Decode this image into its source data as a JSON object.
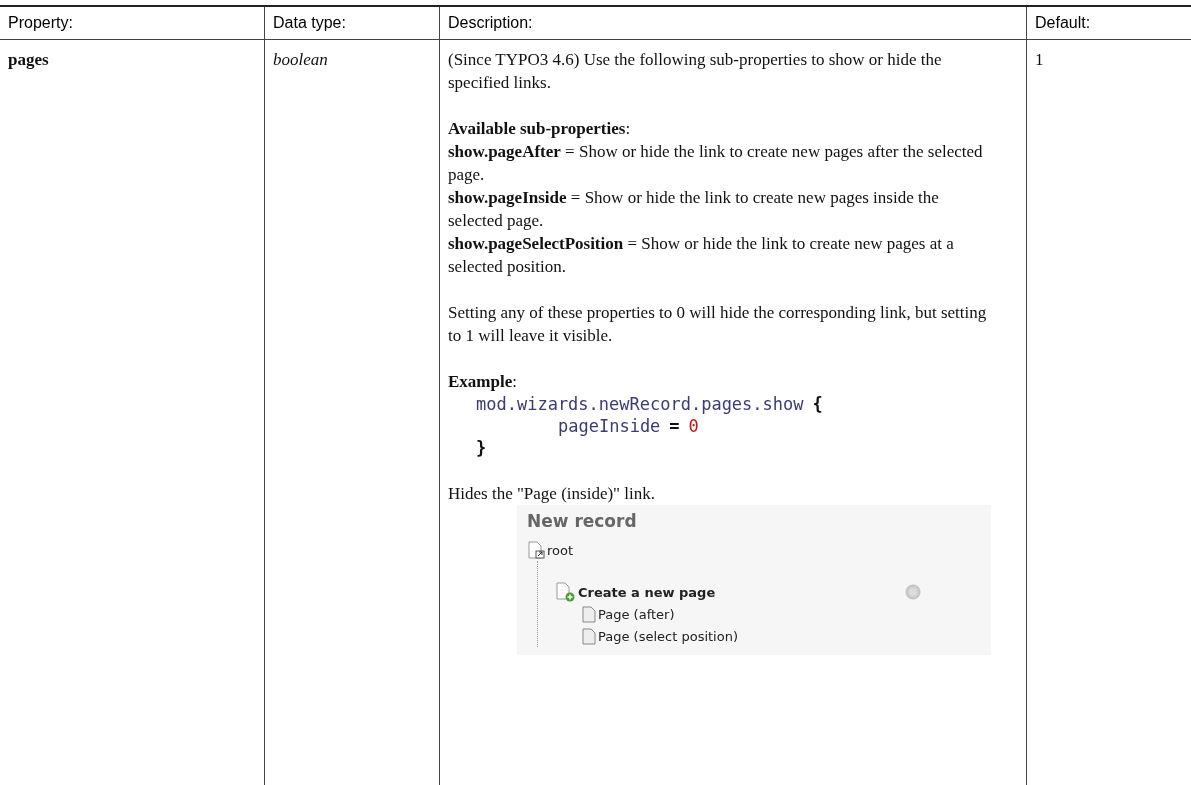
{
  "table": {
    "columns": [
      "Property:",
      "Data type:",
      "Description:",
      "Default:"
    ],
    "rows": [
      {
        "property": "pages",
        "data_type": "boolean",
        "default": "1",
        "description": [
          {
            "kind": "text",
            "text": "(Since TYPO3 4.6) Use the following sub-properties to show or hide the specified links."
          },
          {
            "kind": "list",
            "items": [
              "**Available sub-properties**:",
              "**show.pageAfter** = Show or hide the link to create new pages after the selected page.",
              "**show.pageInside** = Show or hide the link to create new pages inside the selected page.",
              "**show.pageSelectPosition** = Show or hide the link to create new pages at a selected position."
            ]
          },
          {
            "kind": "text",
            "text": "Setting any of these properties to 0 will hide the corresponding link, but setting to 1 will leave it visible."
          },
          {
            "kind": "code",
            "label": "**Example**:",
            "lines": [
              [
                {
                  "kind": "ident",
                  "text": "mod.wizards.newRecord.pages.show"
                },
                {
                  "kind": "op",
                  "text": "{"
                }
              ],
              [
                {
                  "kind": "ident",
                  "text": "pageInside"
                },
                {
                  "kind": "op",
                  "text": "="
                },
                {
                  "kind": "number",
                  "text": "0"
                }
              ],
              [
                {
                  "kind": "op",
                  "text": "}"
                }
              ]
            ]
          },
          {
            "kind": "screenshot",
            "caption": "Hides the \"Page (inside)\" link.",
            "panel": {
              "title": "New record",
              "root": "root",
              "group": "Create a new page",
              "children": [
                "Page (after)",
                "Page (select position)"
              ]
            }
          }
        ]
      }
    ]
  }
}
